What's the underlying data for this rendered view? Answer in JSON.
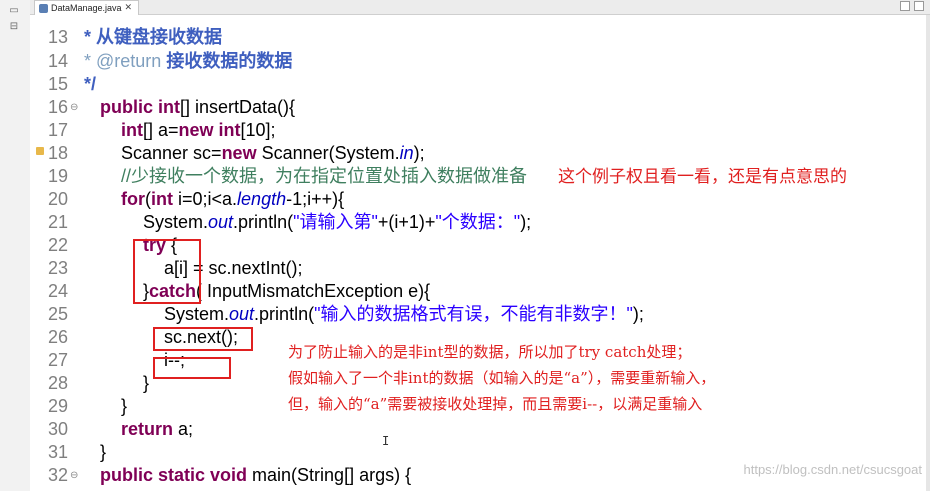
{
  "editor": {
    "tab_title": "DataManage.java",
    "close_glyph": "✕"
  },
  "line_numbers": [
    "13",
    "14",
    "15",
    "16",
    "17",
    "18",
    "19",
    "20",
    "21",
    "22",
    "23",
    "24",
    "25",
    "26",
    "27",
    "28",
    "29",
    "30",
    "31",
    "32"
  ],
  "code": {
    "l13": "* 从键盘接收数据",
    "l14_tag": "* @return",
    "l14_text": " 接收数据的数据",
    "l15": "*/",
    "l16_kw": "public int",
    "l16_rest": "[] insertData(){",
    "l17_kw1": "int",
    "l17_mid": "[] a=",
    "l17_kw2": "new int",
    "l17_rest": "[10];",
    "l18_a": "Scanner sc=",
    "l18_kw": "new",
    "l18_b": " Scanner(System.",
    "l18_fld": "in",
    "l18_c": ");",
    "l19": "//少接收一个数据，为在指定位置处插入数据做准备",
    "l20_kw1": "for",
    "l20_a": "(",
    "l20_kw2": "int",
    "l20_b": " i=0;i<a.",
    "l20_fld": "length",
    "l20_c": "-1;i++){",
    "l21_a": "System.",
    "l21_fld": "out",
    "l21_b": ".println(",
    "l21_s1": "\"请输入第\"",
    "l21_c": "+(i+1)+",
    "l21_s2": "\"个数据：\"",
    "l21_d": ");",
    "l22_kw": "try",
    "l22_rest": " {",
    "l23": "a[i] = sc.nextInt();",
    "l24_a": "}",
    "l24_kw": "catch",
    "l24_b": "( InputMismatchException e){",
    "l25_a": "System.",
    "l25_fld": "out",
    "l25_b": ".println(",
    "l25_s": "\"输入的数据格式有误，不能有非数字！\"",
    "l25_c": ");",
    "l26": "sc.next();",
    "l27": "i--;",
    "l28": "}",
    "l29": "}",
    "l30_kw": "return",
    "l30_rest": " a;",
    "l31": "}",
    "l32_kw": "public static void",
    "l32_rest": " main(String[] args) {"
  },
  "annotations": {
    "note1": "这个例子权且看一看，还是有点意思的",
    "note2_line1": "为了防止输入的是非int型的数据，所以加了try catch处理；",
    "note2_line2": "假如输入了一个非int的数据（如输入的是“a”），需要重新输入，",
    "note2_line3": "但，输入的“a”需要被接收处理掉，而且需要i--，以满足重输入"
  },
  "watermark": "https://blog.csdn.net/csucsgoat",
  "colors": {
    "keyword": "#7f0055",
    "comment": "#3f5fbf",
    "string": "#2a00ff",
    "annotation_red": "#e02020"
  }
}
